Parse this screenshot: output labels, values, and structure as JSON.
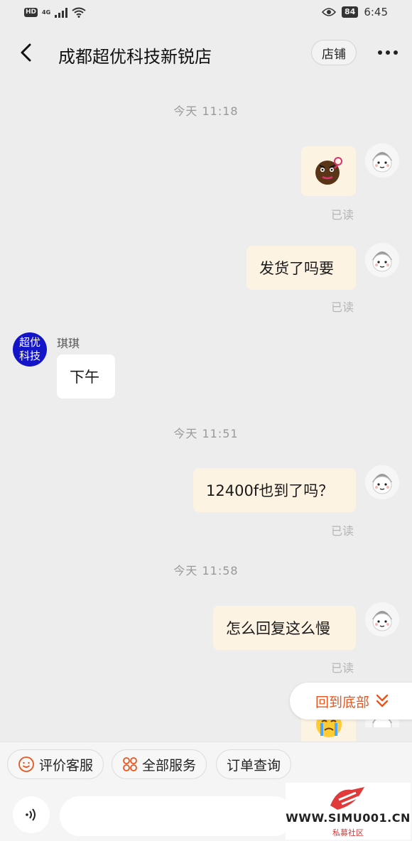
{
  "status_bar": {
    "hd_badge": "HD",
    "network": "4G",
    "battery": "84",
    "time": "6:45"
  },
  "nav": {
    "title": "成都超优科技新锐店",
    "shop_button": "店铺"
  },
  "messages": {
    "time_1": "今天  11:18",
    "read_1": "已读",
    "msg_2": "发货了吗要",
    "read_2": "已读",
    "shop_avatar_text": "超优\n科技",
    "sender_name": "琪琪",
    "reply_1": "下午",
    "time_2": "今天  11:51",
    "msg_3": "12400f也到了吗？",
    "read_3": "已读",
    "time_3": "今天  11:58",
    "msg_4": "怎么回复这么慢",
    "read_4": "已读"
  },
  "back_to_bottom": "回到底部",
  "quick_actions": {
    "rate_service": "评价客服",
    "all_services": "全部服务",
    "order_query": "订单查询"
  },
  "watermark": {
    "site": "WWW.SIMU001.CN",
    "subtitle": "私募社区"
  },
  "colors": {
    "accent": "#e8551e",
    "bubble_self": "#fdf3e3",
    "shop_avatar": "#1414c9"
  }
}
